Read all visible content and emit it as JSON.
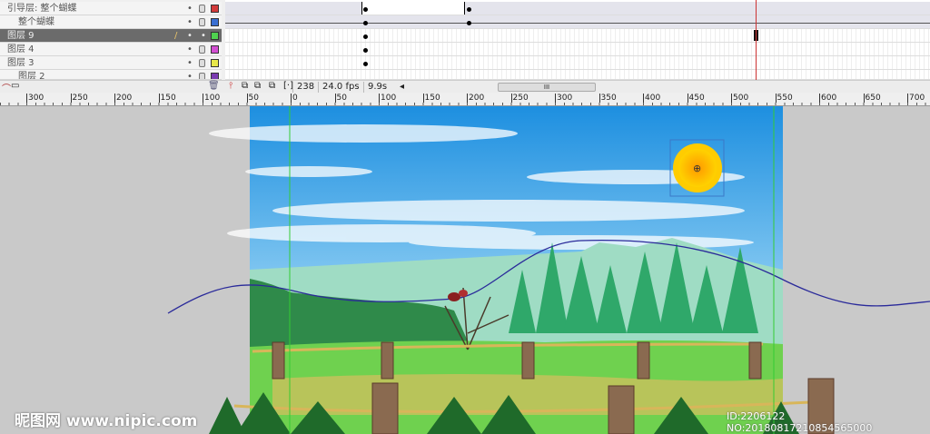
{
  "timeline": {
    "layers": [
      {
        "name": "引导层: 整个蝴蝶",
        "color": "#d23a3a",
        "selected": false
      },
      {
        "name": "整个蝴蝶",
        "color": "#3a6fd2",
        "selected": false
      },
      {
        "name": "图层 9",
        "color": "#4fd24f",
        "selected": true
      },
      {
        "name": "图层 4",
        "color": "#d24fd2",
        "selected": false
      },
      {
        "name": "图层 3",
        "color": "#e8e84a",
        "selected": false
      },
      {
        "name": "图层 2",
        "color": "#7a3ab0",
        "selected": false
      }
    ],
    "current_frame": "238",
    "fps": "24.0 fps",
    "elapsed": "9.9s",
    "scroll_label": "III",
    "scroll_left": "◂"
  },
  "ruler": {
    "labels": [
      "300",
      "250",
      "200",
      "150",
      "100",
      "50",
      "0",
      "50",
      "100",
      "150",
      "200",
      "250",
      "300",
      "350",
      "400",
      "450",
      "500",
      "550",
      "600",
      "650",
      "700"
    ]
  },
  "watermark": {
    "site": "昵图网 www.nipic.com",
    "id": "ID:2206122 NO:20180817210854565000"
  }
}
